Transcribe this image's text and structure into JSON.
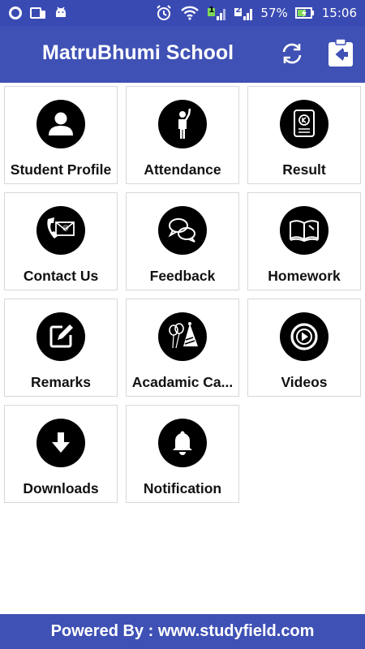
{
  "status_bar": {
    "signal_badge_1": "1",
    "signal_badge_2": "2",
    "battery": "57%",
    "time": "15:06"
  },
  "app_bar": {
    "title": "MatruBhumi School",
    "refresh_icon": "refresh-icon",
    "logout_icon": "logout-icon"
  },
  "tiles": [
    {
      "label": "Student Profile",
      "icon": "person-icon"
    },
    {
      "label": "Attendance",
      "icon": "raised-hand-person-icon"
    },
    {
      "label": "Result",
      "icon": "report-card-icon"
    },
    {
      "label": "Contact Us",
      "icon": "contact-envelope-icon"
    },
    {
      "label": "Feedback",
      "icon": "chat-bubbles-icon"
    },
    {
      "label": "Homework",
      "icon": "open-book-icon"
    },
    {
      "label": "Remarks",
      "icon": "edit-note-icon"
    },
    {
      "label": "Acadamic Ca...",
      "icon": "party-balloons-icon"
    },
    {
      "label": "Videos",
      "icon": "play-circle-icon"
    },
    {
      "label": "Downloads",
      "icon": "download-arrow-icon"
    },
    {
      "label": "Notification",
      "icon": "bell-icon"
    }
  ],
  "footer": {
    "text": "Powered By : www.studyfield.com"
  },
  "colors": {
    "primary": "#3f51b5",
    "status_bar": "#3a4ab3",
    "battery_accent": "#7ed957"
  }
}
